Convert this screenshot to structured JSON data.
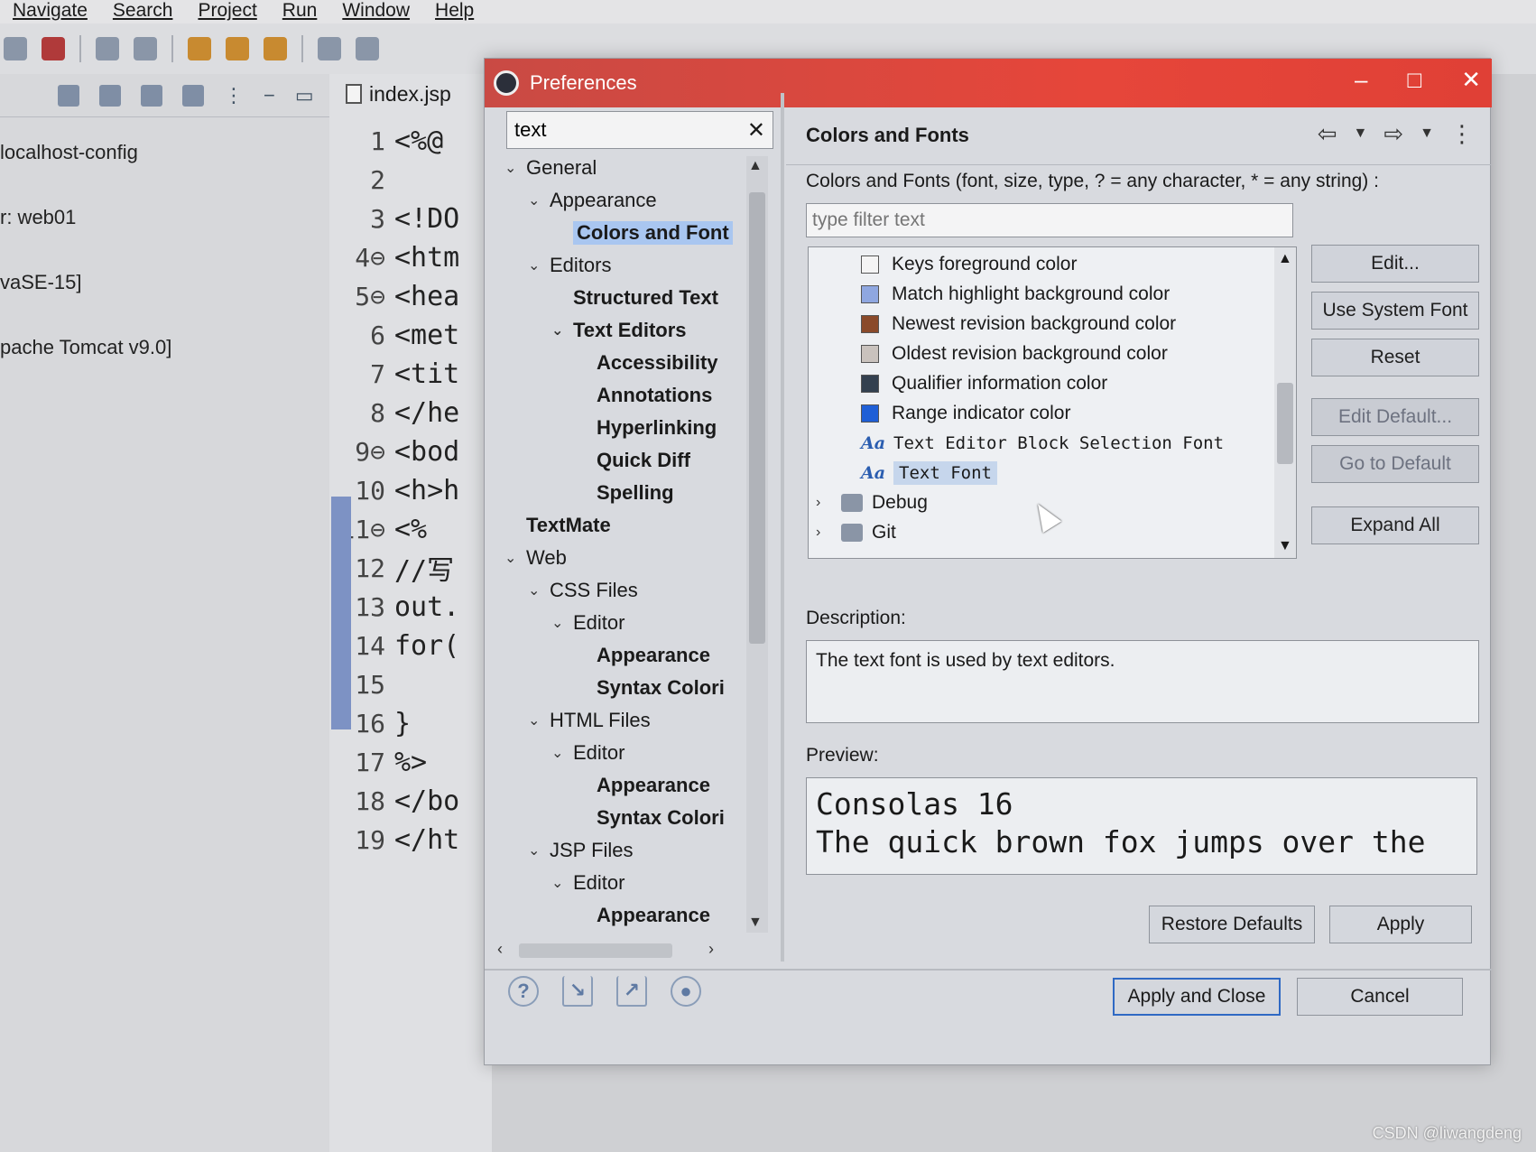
{
  "menubar": {
    "items": [
      "Navigate",
      "Search",
      "Project",
      "Run",
      "Window",
      "Help"
    ]
  },
  "left_view": {
    "lines": [
      "localhost-config",
      "r: web01",
      "vaSE-15]",
      "pache Tomcat v9.0]"
    ]
  },
  "editor": {
    "tab_label": "index.jsp",
    "lines": [
      {
        "n": "1",
        "code": "<%@"
      },
      {
        "n": "2",
        "code": ""
      },
      {
        "n": "3",
        "code": "<!DO"
      },
      {
        "n": "4⊖",
        "code": "<htm"
      },
      {
        "n": "5⊖",
        "code": "<hea"
      },
      {
        "n": "6",
        "code": "<met"
      },
      {
        "n": "7",
        "code": "<tit"
      },
      {
        "n": "8",
        "code": "</he"
      },
      {
        "n": "9⊖",
        "code": "<bod"
      },
      {
        "n": "10",
        "code": "<h>h"
      },
      {
        "n": "11⊖",
        "code": "<%"
      },
      {
        "n": "12",
        "code": "//写"
      },
      {
        "n": "13",
        "code": "out."
      },
      {
        "n": "14",
        "code": "for("
      },
      {
        "n": "15",
        "code": ""
      },
      {
        "n": "16",
        "code": "}"
      },
      {
        "n": "17",
        "code": "%>"
      },
      {
        "n": "18",
        "code": "</bo"
      },
      {
        "n": "19",
        "code": "</ht"
      }
    ]
  },
  "dialog": {
    "title": "Preferences",
    "filter_value": "text",
    "tree": [
      {
        "label": "General",
        "level": 0,
        "twisty": "⌄",
        "bold": false
      },
      {
        "label": "Appearance",
        "level": 1,
        "twisty": "⌄",
        "bold": false
      },
      {
        "label": "Colors and Font",
        "level": 2,
        "twisty": "",
        "bold": true,
        "selected": true
      },
      {
        "label": "Editors",
        "level": 1,
        "twisty": "⌄",
        "bold": false
      },
      {
        "label": "Structured Text",
        "level": 2,
        "twisty": "",
        "bold": true
      },
      {
        "label": "Text Editors",
        "level": 2,
        "twisty": "⌄",
        "bold": true
      },
      {
        "label": "Accessibility",
        "level": 3,
        "twisty": "",
        "bold": true
      },
      {
        "label": "Annotations",
        "level": 3,
        "twisty": "",
        "bold": true
      },
      {
        "label": "Hyperlinking",
        "level": 3,
        "twisty": "",
        "bold": true
      },
      {
        "label": "Quick Diff",
        "level": 3,
        "twisty": "",
        "bold": true
      },
      {
        "label": "Spelling",
        "level": 3,
        "twisty": "",
        "bold": true
      },
      {
        "label": "TextMate",
        "level": 0,
        "twisty": "",
        "bold": true
      },
      {
        "label": "Web",
        "level": 0,
        "twisty": "⌄",
        "bold": false
      },
      {
        "label": "CSS Files",
        "level": 1,
        "twisty": "⌄",
        "bold": false
      },
      {
        "label": "Editor",
        "level": 2,
        "twisty": "⌄",
        "bold": false
      },
      {
        "label": "Appearance",
        "level": 3,
        "twisty": "",
        "bold": true
      },
      {
        "label": "Syntax Colori",
        "level": 3,
        "twisty": "",
        "bold": true
      },
      {
        "label": "HTML Files",
        "level": 1,
        "twisty": "⌄",
        "bold": false
      },
      {
        "label": "Editor",
        "level": 2,
        "twisty": "⌄",
        "bold": false
      },
      {
        "label": "Appearance",
        "level": 3,
        "twisty": "",
        "bold": true
      },
      {
        "label": "Syntax Colori",
        "level": 3,
        "twisty": "",
        "bold": true
      },
      {
        "label": "JSP Files",
        "level": 1,
        "twisty": "⌄",
        "bold": false
      },
      {
        "label": "Editor",
        "level": 2,
        "twisty": "⌄",
        "bold": false
      },
      {
        "label": "Appearance",
        "level": 3,
        "twisty": "",
        "bold": true
      }
    ],
    "page": {
      "title": "Colors and Fonts",
      "description": "Colors and Fonts (font, size, type, ? = any character, * = any string) :",
      "filter_placeholder": "type filter text",
      "items": [
        {
          "kind": "color",
          "label": "Keys foreground color",
          "color": "#f4f4f4"
        },
        {
          "kind": "color",
          "label": "Match highlight background color",
          "color": "#8fa7e0"
        },
        {
          "kind": "color",
          "label": "Newest revision background color",
          "color": "#8a4a2a"
        },
        {
          "kind": "color",
          "label": "Oldest revision background color",
          "color": "#c9c2bd"
        },
        {
          "kind": "color",
          "label": "Qualifier information color",
          "color": "#33404f"
        },
        {
          "kind": "color",
          "label": "Range indicator color",
          "color": "#1f5fd6"
        },
        {
          "kind": "font",
          "label": "Text Editor Block Selection Font"
        },
        {
          "kind": "font",
          "label": "Text Font",
          "selected": true
        },
        {
          "kind": "folder",
          "label": "Debug"
        },
        {
          "kind": "folder",
          "label": "Git"
        }
      ],
      "buttons": {
        "edit": "Edit...",
        "use_system_font": "Use System Font",
        "reset": "Reset",
        "edit_default": "Edit Default...",
        "go_to_default": "Go to Default",
        "expand_all": "Expand All"
      },
      "description_label": "Description:",
      "description_text": "The text font is used by text editors.",
      "preview_label": "Preview:",
      "preview_line1": "Consolas 16",
      "preview_line2": "The quick brown fox jumps over the",
      "restore_defaults": "Restore Defaults",
      "apply": "Apply"
    },
    "footer": {
      "apply_and_close": "Apply and Close",
      "cancel": "Cancel"
    }
  },
  "watermark": "CSDN @liwangdeng"
}
